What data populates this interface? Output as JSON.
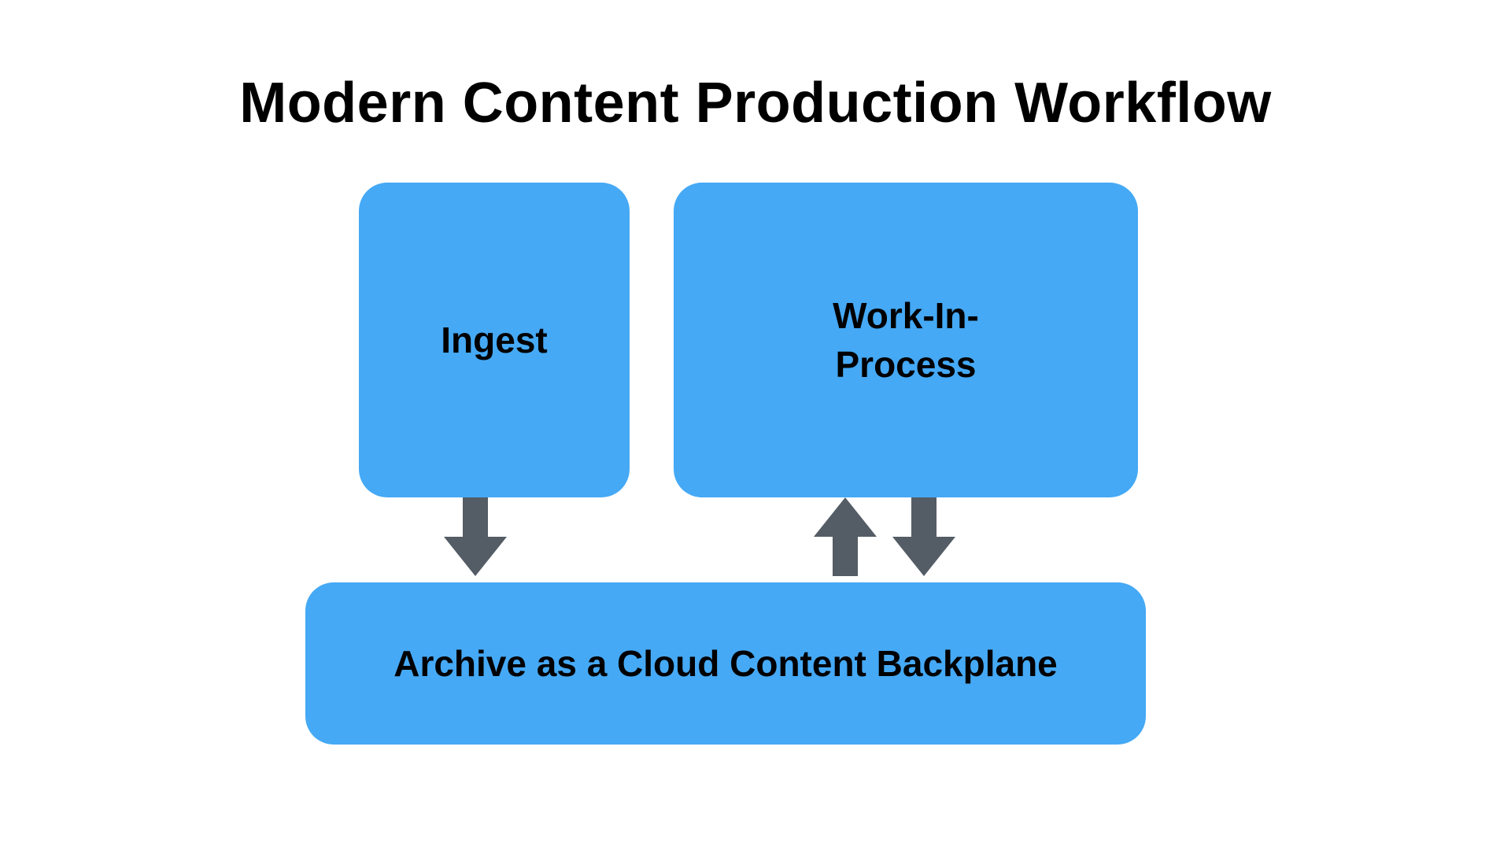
{
  "title": "Modern Content Production Workflow",
  "nodes": {
    "ingest": {
      "label": "Ingest"
    },
    "wip": {
      "label": "Work-In-\nProcess"
    },
    "archive": {
      "label": "Archive as a Cloud Content Backplane"
    }
  },
  "edges": [
    {
      "from": "ingest",
      "to": "archive",
      "direction": "down"
    },
    {
      "from": "archive",
      "to": "wip",
      "direction": "up"
    },
    {
      "from": "wip",
      "to": "archive",
      "direction": "down"
    }
  ],
  "colors": {
    "node_fill": "#45a9f5",
    "arrow_fill": "#545c65",
    "text": "#000000",
    "background": "#ffffff"
  }
}
